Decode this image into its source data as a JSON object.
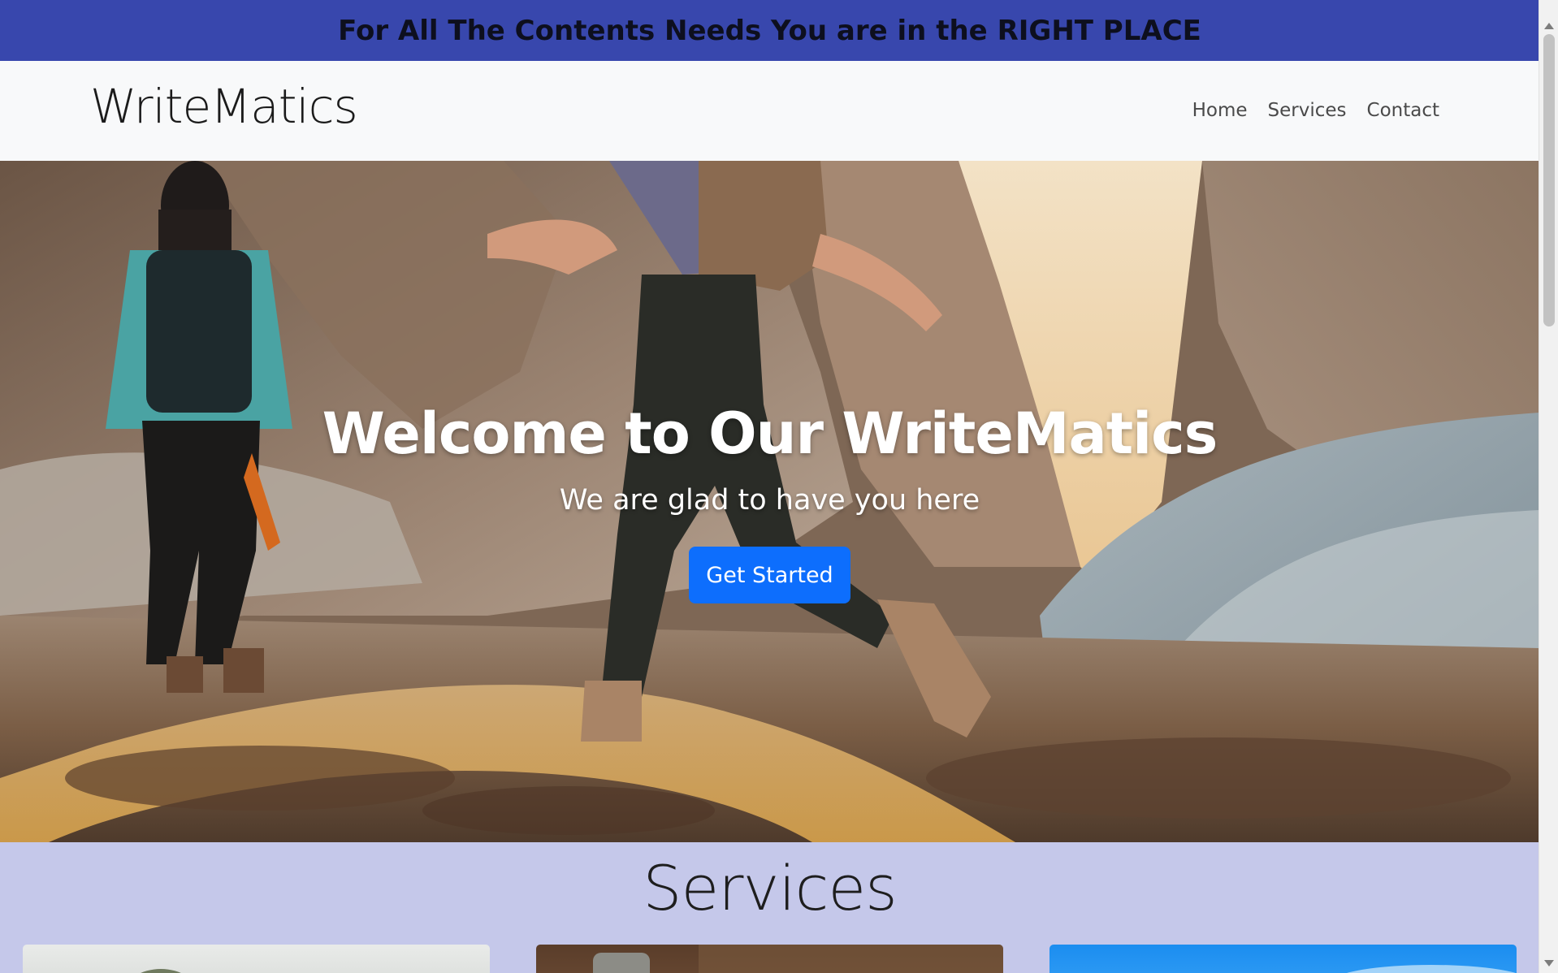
{
  "banner": {
    "text": "For All The Contents Needs You are in the RIGHT PLACE"
  },
  "navbar": {
    "brand": "WriteMatics",
    "links": [
      "Home",
      "Services",
      "Contact"
    ]
  },
  "hero": {
    "title": "Welcome to Our WriteMatics",
    "subtitle": "We are glad to have you here",
    "button_label": "Get Started"
  },
  "services": {
    "title": "Services"
  },
  "colors": {
    "banner_bg": "#3847ad",
    "navbar_bg": "#f8f9fa",
    "button_bg": "#0d6efd",
    "services_bg": "#c5c8ea"
  }
}
